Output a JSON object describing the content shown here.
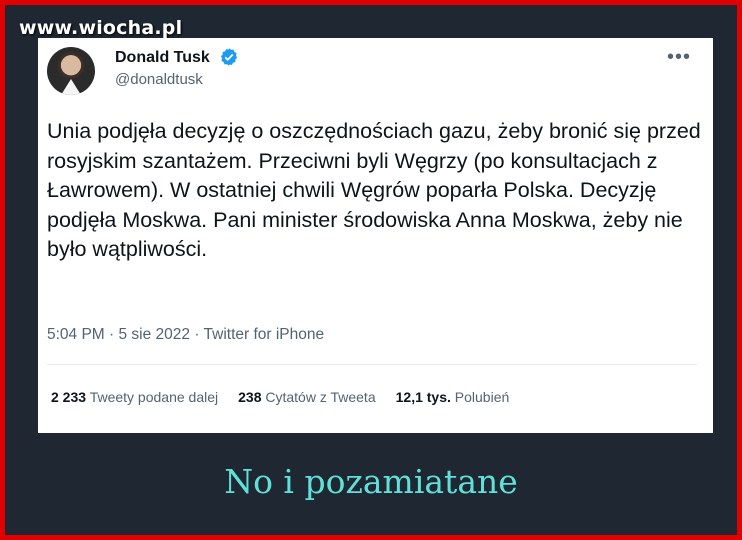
{
  "watermark": "www.wiocha.pl",
  "tweet": {
    "author_name": "Donald Tusk",
    "handle": "@donaldtusk",
    "text": "Unia podjęła decyzję o oszczędnościach gazu, żeby bronić się przed rosyjskim szantażem. Przeciwni byli Węgrzy (po konsultacjach z Ławrowem). W ostatniej chwili Węgrów poparła Polska. Decyzję podjęła Moskwa. Pani minister środowiska Anna Moskwa, żeby nie było wątpliwości.",
    "meta": "5:04 PM · 5 sie 2022 · Twitter for iPhone",
    "stats": {
      "retweets_count": "2 233",
      "retweets_label": "Tweety podane dalej",
      "quotes_count": "238",
      "quotes_label": "Cytatów z Tweeta",
      "likes_count": "12,1 tys.",
      "likes_label": "Polubień"
    }
  },
  "caption": "No i pozamiatane",
  "icons": [
    "verified-badge-icon",
    "more-options-icon",
    "avatar"
  ],
  "colors": {
    "frame_border": "#e00000",
    "background": "#1f2732",
    "caption": "#5fe0d8",
    "verified": "#1d9bf0"
  }
}
